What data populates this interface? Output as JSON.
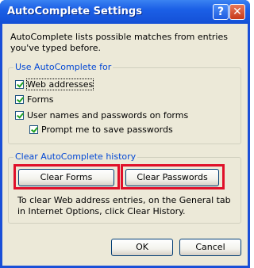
{
  "window": {
    "title": "AutoComplete Settings",
    "help_label": "?",
    "close_label": "✕"
  },
  "intro": "AutoComplete lists possible matches from entries you've typed before.",
  "use_group": {
    "legend": "Use AutoComplete for",
    "options": [
      {
        "label": "Web addresses",
        "checked": true
      },
      {
        "label": "Forms",
        "checked": true
      },
      {
        "label": "User names and passwords on forms",
        "checked": true
      },
      {
        "label": "Prompt me to save passwords",
        "checked": true
      }
    ]
  },
  "history_group": {
    "legend": "Clear AutoComplete history",
    "clear_forms_label": "Clear Forms",
    "clear_passwords_label": "Clear Passwords",
    "note": "To clear Web address entries, on the General tab in Internet Options, click Clear History."
  },
  "footer": {
    "ok_label": "OK",
    "cancel_label": "Cancel"
  },
  "colors": {
    "title_bar": "#1b5fe6",
    "dialog_face": "#ece9d8",
    "legend_text": "#0046d5",
    "highlight": "#e0102a"
  }
}
